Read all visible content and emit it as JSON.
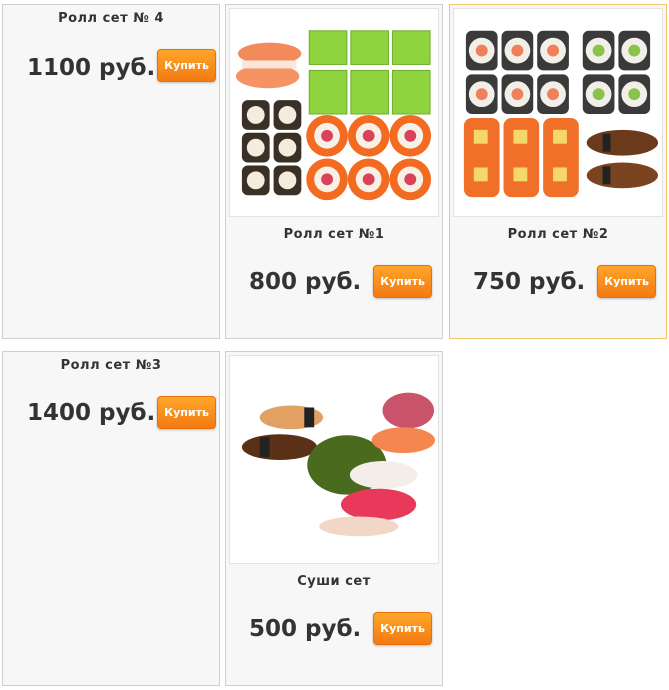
{
  "products": [
    {
      "name": "Ролл сет № 4",
      "price": "1100 руб.",
      "buy_label": "Купить",
      "image": "roll-set-4-image"
    },
    {
      "name": "Ролл сет №1",
      "price": "800 руб.",
      "buy_label": "Купить",
      "image": "roll-set-1-image"
    },
    {
      "name": "Ролл сет №2",
      "price": "750 руб.",
      "buy_label": "Купить",
      "image": "roll-set-2-image"
    },
    {
      "name": "Ролл сет №3",
      "price": "1400 руб.",
      "buy_label": "Купить",
      "image": "roll-set-3-image"
    },
    {
      "name": "Суши сет",
      "price": "500 руб.",
      "buy_label": "Купить",
      "image": "sushi-set-image"
    }
  ],
  "colors": {
    "card_background": "#f7f7f7",
    "card_border": "#cfcfcf",
    "card_highlight_border": "#f2c66a",
    "button_orange": "#f47a11"
  }
}
